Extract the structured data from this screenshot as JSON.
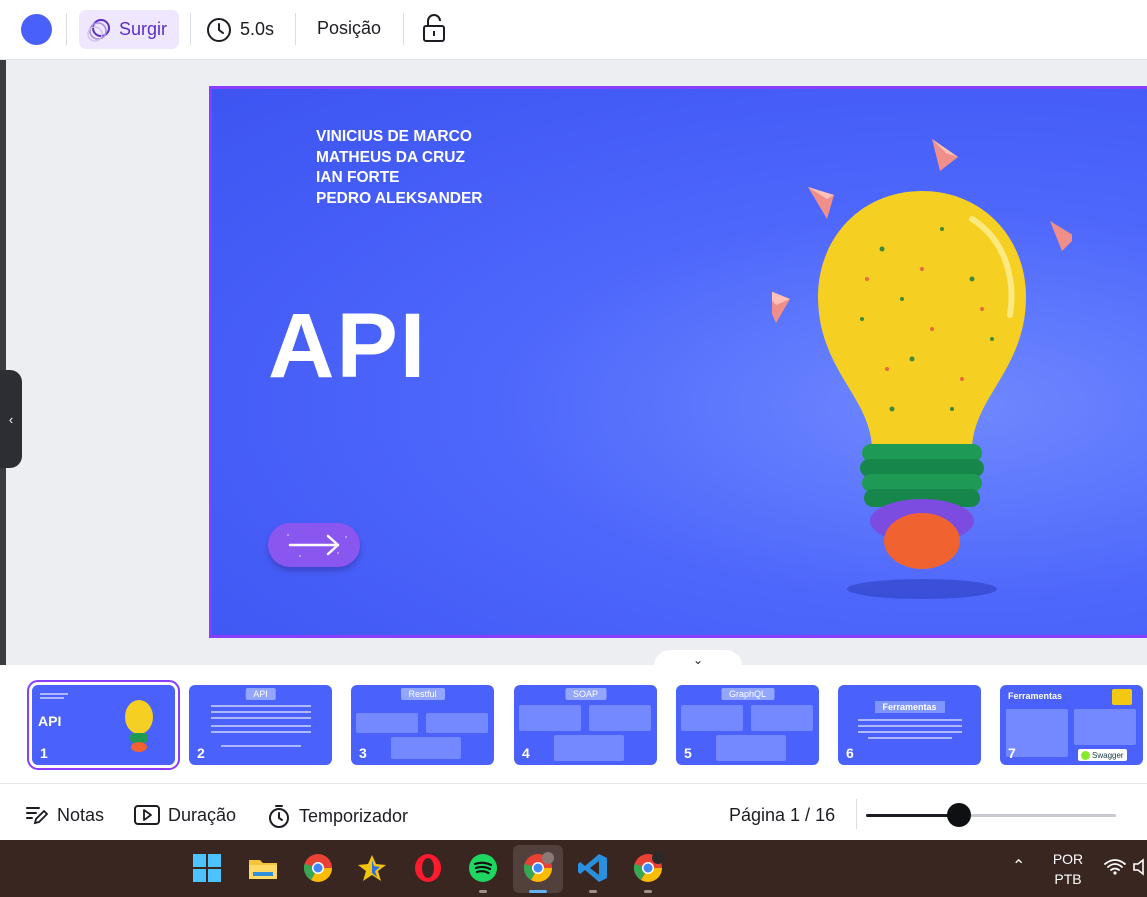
{
  "toolbar": {
    "color_swatch": "#4960fb",
    "animation_label": "Surgir",
    "duration_label": "5.0s",
    "position_label": "Posição",
    "icons": [
      "color-swatch",
      "animation-icon",
      "clock-icon",
      "lock-icon"
    ]
  },
  "slide": {
    "authors": [
      "VINICIUS DE MARCO",
      "MATHEUS DA CRUZ",
      "IAN FORTE",
      "PEDRO ALEKSANDER"
    ],
    "title": "API",
    "background_color": "#4d66fb",
    "border_color": "#8b3dff"
  },
  "thumbnails": [
    {
      "number": "1",
      "label": "API"
    },
    {
      "number": "2",
      "label": "API"
    },
    {
      "number": "3",
      "label": "Restful"
    },
    {
      "number": "4",
      "label": "SOAP"
    },
    {
      "number": "5",
      "label": "GraphQL"
    },
    {
      "number": "6",
      "label": "Ferramentas"
    },
    {
      "number": "7",
      "label": "Ferramentas",
      "brand": "Swagger"
    }
  ],
  "footer": {
    "notes_label": "Notas",
    "duration_label": "Duração",
    "timer_label": "Temporizador",
    "page_label": "Página 1 / 16",
    "zoom_level": 0.37
  },
  "taskbar": {
    "apps": [
      "windows-start",
      "file-explorer",
      "chrome",
      "star-app",
      "opera",
      "spotify",
      "chrome-profile-m",
      "vscode",
      "chrome-profile"
    ],
    "language_line1": "POR",
    "language_line2": "PTB"
  }
}
